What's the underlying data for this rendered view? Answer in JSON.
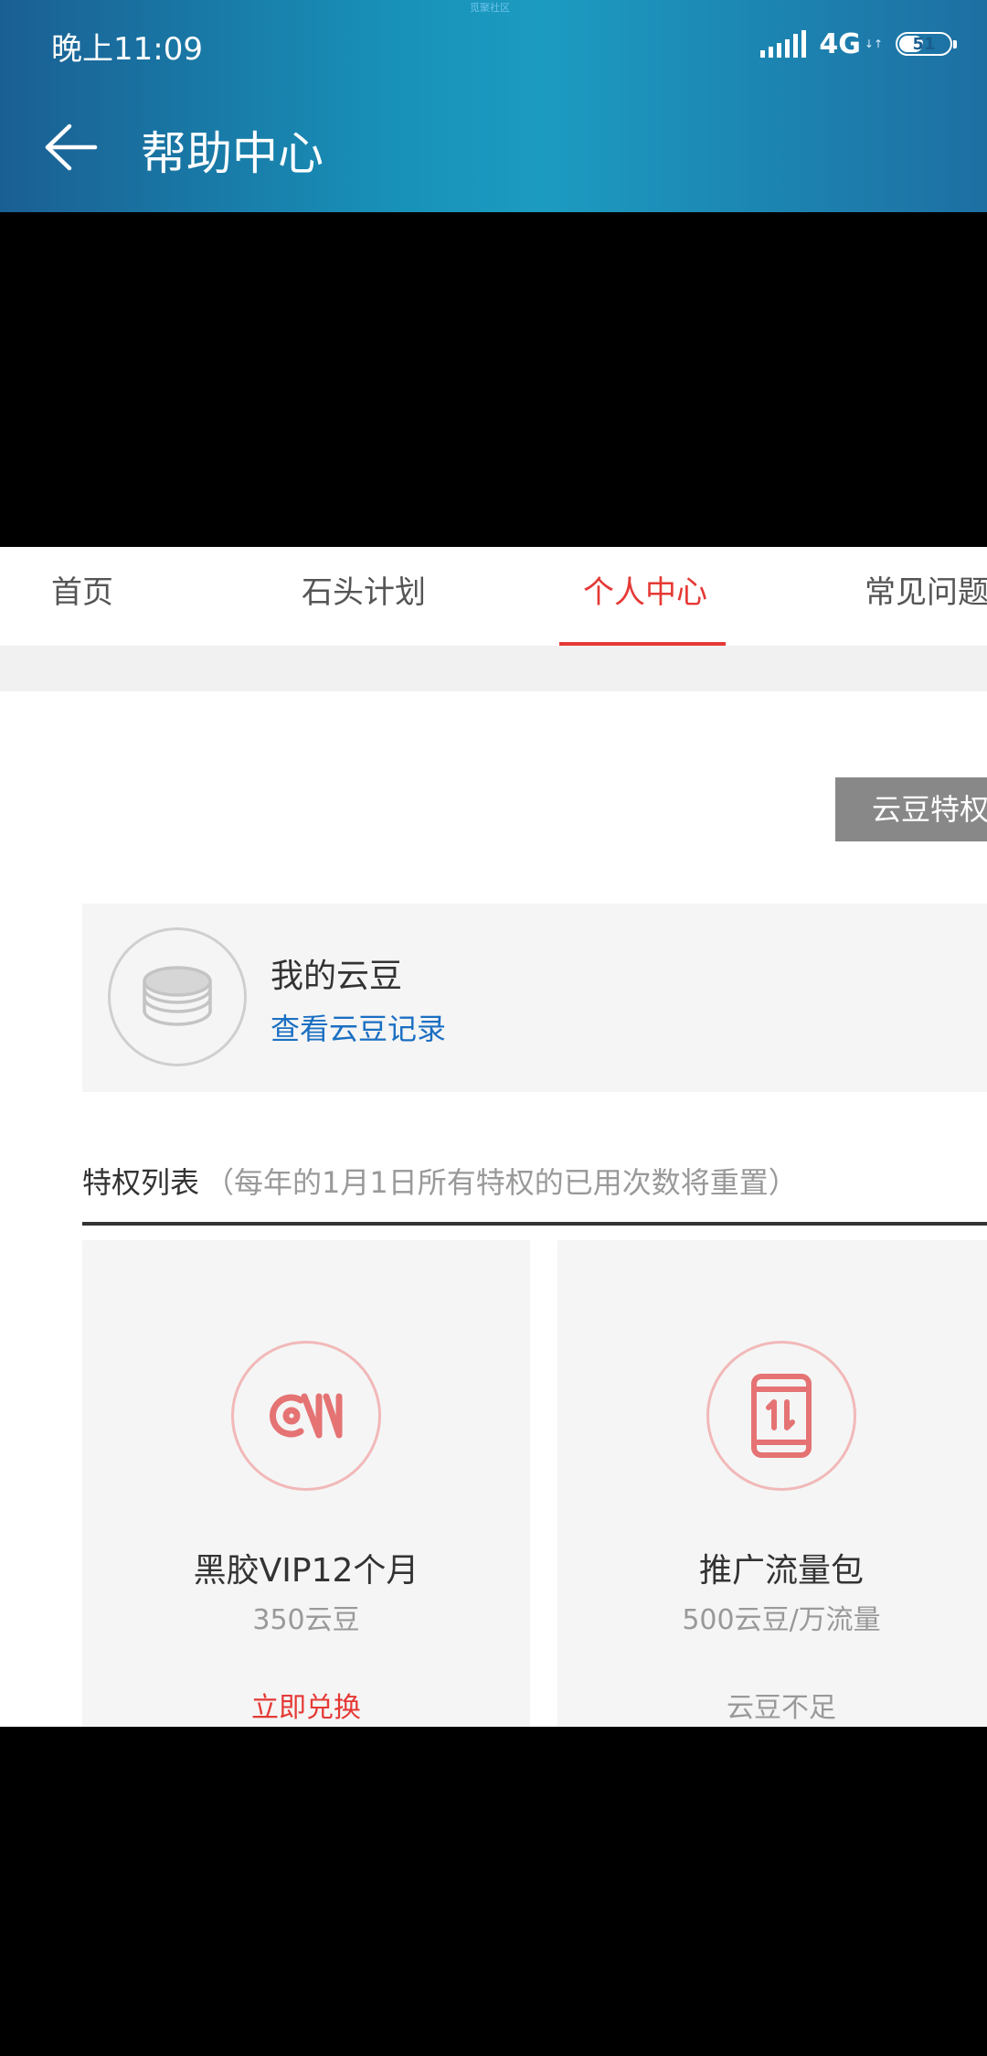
{
  "status_bar": {
    "tiny_label": "觅聚社区",
    "time": "晚上11:09",
    "network": "4G",
    "battery": "51",
    "battery_level": 0.51
  },
  "app_bar": {
    "title": "帮助中心",
    "back_icon": "arrow-left-icon"
  },
  "tabs": [
    {
      "label": "首页",
      "active": false
    },
    {
      "label": "石头计划",
      "active": false
    },
    {
      "label": "个人中心",
      "active": true
    },
    {
      "label": "常见问题",
      "active": false
    }
  ],
  "privilege_button": "云豆特权",
  "beans": {
    "title": "我的云豆",
    "link": "查看云豆记录",
    "icon": "coins-icon"
  },
  "list": {
    "title": "特权列表",
    "note": "（每年的1月1日所有特权的已用次数将重置）"
  },
  "privileges": [
    {
      "name": "黑胶VIP12个月",
      "cost": "350云豆",
      "action": "立即兑换",
      "action_color": "#e53935",
      "icon": "vinyl-vip-icon"
    },
    {
      "name": "推广流量包",
      "cost": "500云豆/万流量",
      "action": "云豆不足",
      "action_color": "#999999",
      "icon": "phone-traffic-icon"
    }
  ],
  "colors": {
    "accent": "#e53935",
    "link": "#1b6fc2",
    "header_start": "#1a5f93",
    "header_end": "#1d6fa2"
  }
}
